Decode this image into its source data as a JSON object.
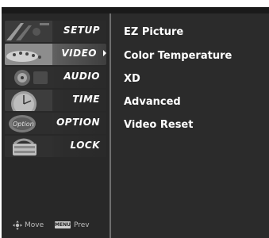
{
  "menu": {
    "items": [
      {
        "label": "SETUP",
        "icon": "setup-thumbnail-icon",
        "selected": false
      },
      {
        "label": "VIDEO",
        "icon": "video-thumbnail-icon",
        "selected": true
      },
      {
        "label": "AUDIO",
        "icon": "audio-thumbnail-icon",
        "selected": false
      },
      {
        "label": "TIME",
        "icon": "time-thumbnail-icon",
        "selected": false
      },
      {
        "label": "OPTION",
        "icon": "option-thumbnail-icon",
        "selected": false
      },
      {
        "label": "LOCK",
        "icon": "lock-thumbnail-icon",
        "selected": false
      }
    ]
  },
  "submenu": {
    "items": [
      {
        "label": "EZ Picture"
      },
      {
        "label": "Color Temperature"
      },
      {
        "label": "XD"
      },
      {
        "label": "Advanced"
      },
      {
        "label": "Video Reset"
      }
    ]
  },
  "footer": {
    "move_label": "Move",
    "menu_button_label": "MENU",
    "prev_label": "Prev"
  },
  "thumb_texts": {
    "option": "Option"
  },
  "colors": {
    "panel": "#282828",
    "selected_highlight": "#8a8a8a",
    "text": "#ffffff"
  }
}
